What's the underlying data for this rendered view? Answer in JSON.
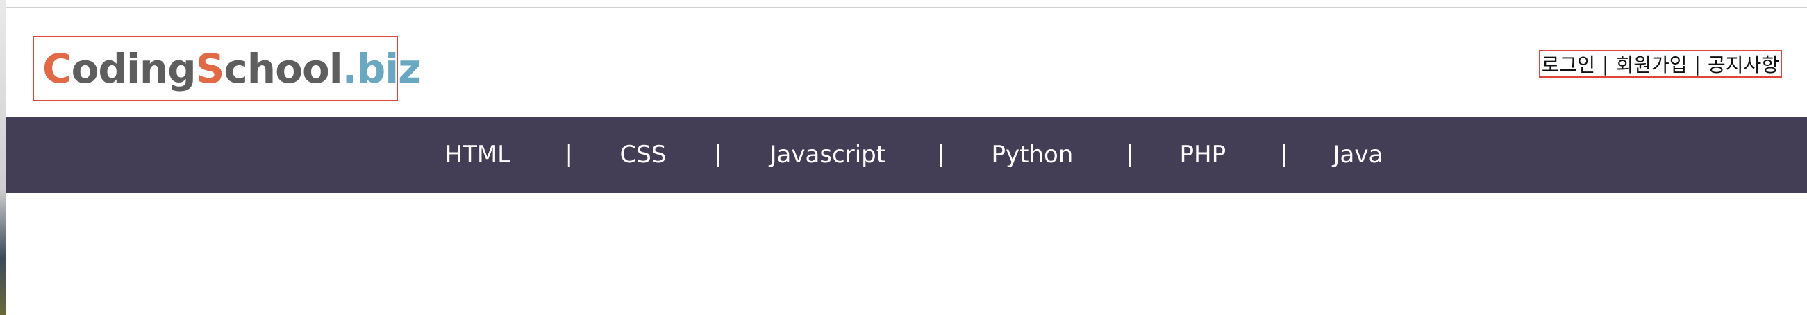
{
  "logo": {
    "part1": "C",
    "part2": "oding",
    "part3": "S",
    "part4": "chool",
    "part5": ".biz"
  },
  "utility_links": {
    "login": "로그인",
    "signup": "회원가입",
    "notice": "공지사항",
    "separator": "|"
  },
  "nav": {
    "items": [
      {
        "label": "HTML"
      },
      {
        "label": "CSS"
      },
      {
        "label": "Javascript"
      },
      {
        "label": "Python"
      },
      {
        "label": "PHP"
      },
      {
        "label": "Java"
      }
    ],
    "separator": "|"
  },
  "colors": {
    "nav_bg": "#433d55",
    "logo_orange": "#e06a46",
    "logo_gray": "#5e5e5e",
    "logo_blue": "#6aa7c1",
    "highlight_border": "#e0453a"
  }
}
